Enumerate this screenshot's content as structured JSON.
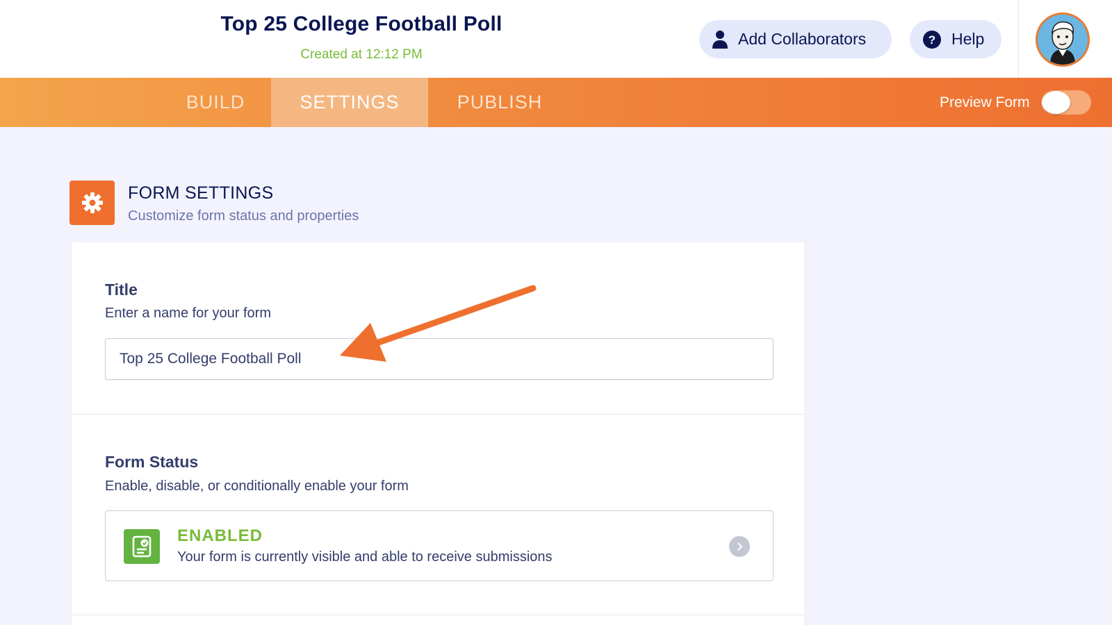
{
  "header": {
    "form_title": "Top 25 College Football Poll",
    "created": "Created at 12:12 PM",
    "add_collaborators_label": "Add Collaborators",
    "help_label": "Help"
  },
  "tabs": [
    {
      "label": "BUILD",
      "active": false
    },
    {
      "label": "SETTINGS",
      "active": true
    },
    {
      "label": "PUBLISH",
      "active": false
    }
  ],
  "preview": {
    "label": "Preview Form",
    "enabled": false
  },
  "section": {
    "title": "FORM SETTINGS",
    "subtitle": "Customize form status and properties"
  },
  "title_field": {
    "label": "Title",
    "description": "Enter a name for your form",
    "value": "Top 25 College Football Poll"
  },
  "status_field": {
    "label": "Form Status",
    "description": "Enable, disable, or conditionally enable your form",
    "status_title": "ENABLED",
    "status_desc": "Your form is currently visible and able to receive submissions"
  },
  "colors": {
    "accent_orange": "#ef6f2e",
    "enabled_green": "#78bb39",
    "navy": "#0a1551"
  }
}
